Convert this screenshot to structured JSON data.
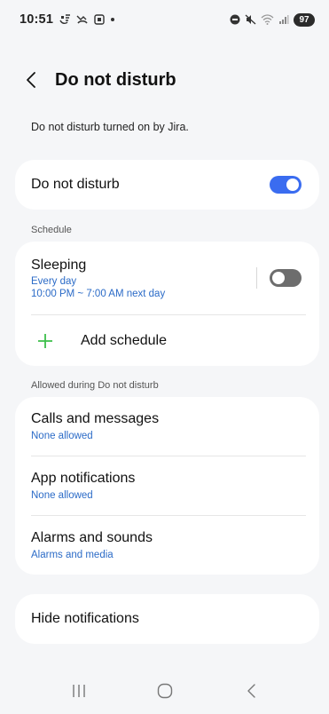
{
  "status_bar": {
    "time": "10:51",
    "battery": "97",
    "left_icons": [
      "wifi-calling-icon",
      "missed-call-icon",
      "screenshot-icon",
      "dot-icon"
    ],
    "right_icons": [
      "dnd-status-icon",
      "mute-icon",
      "wifi-icon",
      "signal-icon",
      "battery-icon"
    ]
  },
  "header": {
    "title": "Do not disturb"
  },
  "info": {
    "text": "Do not disturb turned on by Jira."
  },
  "dnd": {
    "label": "Do not disturb",
    "enabled": true
  },
  "schedule": {
    "section_label": "Schedule",
    "items": [
      {
        "title": "Sleeping",
        "days": "Every day",
        "time": "10:00 PM ~ 7:00 AM next day",
        "enabled": false
      }
    ],
    "add_label": "Add schedule"
  },
  "allowed": {
    "section_label": "Allowed during Do not disturb",
    "items": [
      {
        "title": "Calls and messages",
        "sub": "None allowed"
      },
      {
        "title": "App notifications",
        "sub": "None allowed"
      },
      {
        "title": "Alarms and sounds",
        "sub": "Alarms and media"
      }
    ]
  },
  "hide": {
    "label": "Hide notifications"
  },
  "colors": {
    "accent": "#3a6cf0",
    "link": "#2b6bc7",
    "add_icon": "#3cbf4a",
    "background": "#f5f6f8"
  },
  "navbar": {
    "icons": [
      "recents-icon",
      "home-icon",
      "back-nav-icon"
    ]
  }
}
